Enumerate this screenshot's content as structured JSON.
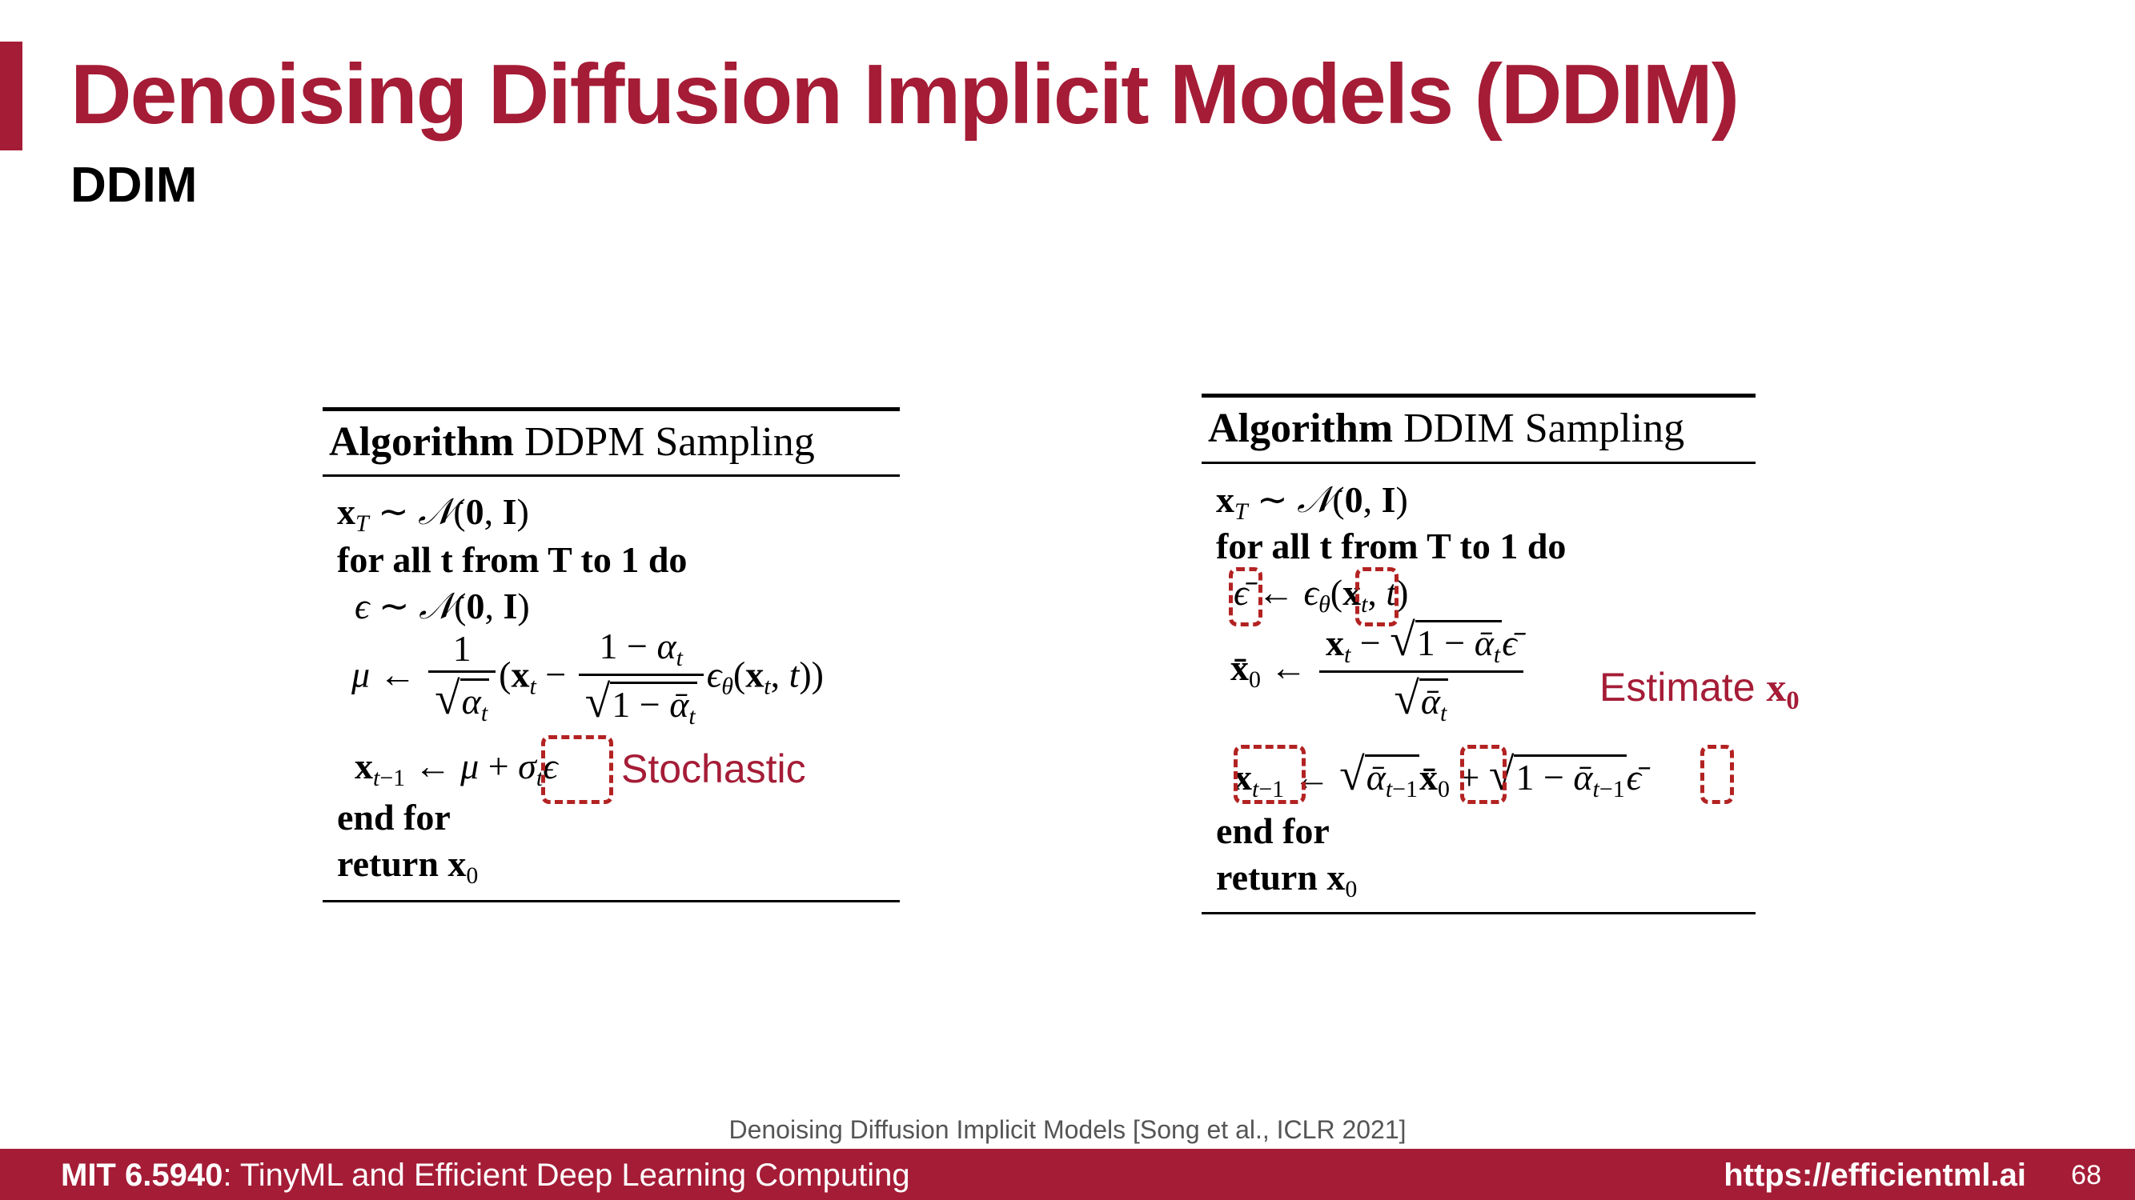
{
  "slide": {
    "title": "Denoising Diffusion Implicit Models (DDIM)",
    "subtitle": "DDIM"
  },
  "ddpm": {
    "head_bold": "Algorithm",
    "head_rest": "DDPM Sampling",
    "line_for": "for all t from T to 1 do",
    "line_endfor": "end for",
    "line_return": "return x0",
    "note": "Stochastic"
  },
  "ddim": {
    "head_bold": "Algorithm",
    "head_rest": "DDIM Sampling",
    "line_for": "for all t from T to 1 do",
    "line_endfor": "end for",
    "line_return": "return x0",
    "note_prefix": "Estimate",
    "note_symbol": "x0"
  },
  "citation": "Denoising Diffusion Implicit Models [Song et al., ICLR 2021]",
  "footer": {
    "course_code": "MIT 6.5940",
    "course_title": ": TinyML and Efficient Deep Learning Computing",
    "url": "https://efficientml.ai",
    "page_number": "68"
  },
  "colors": {
    "accent": "#a51c36",
    "highlight_box": "#b32222"
  }
}
